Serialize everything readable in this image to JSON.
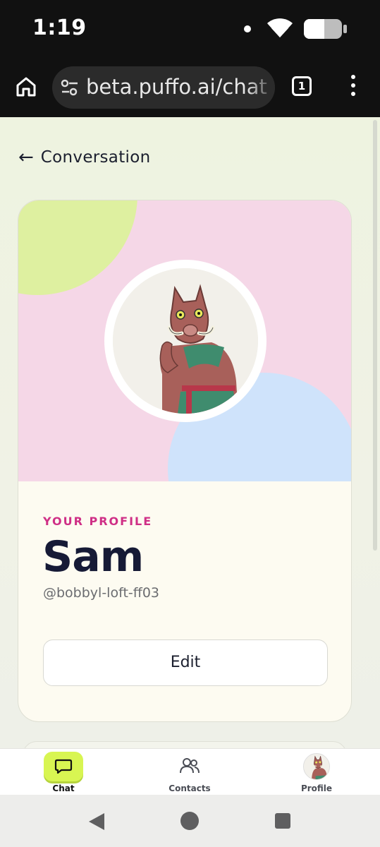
{
  "status_bar": {
    "time": "1:19"
  },
  "browser": {
    "url": "beta.puffo.ai/chat",
    "tab_count": "1"
  },
  "page": {
    "back_label": "Conversation",
    "profile": {
      "eyebrow": "YOUR PROFILE",
      "name": "Sam",
      "handle": "@bobbyl-loft-ff03",
      "edit_label": "Edit"
    }
  },
  "bottom_nav": {
    "items": [
      {
        "label": "Chat",
        "icon": "chat-bubble-icon",
        "active": true
      },
      {
        "label": "Contacts",
        "icon": "contacts-icon",
        "active": false
      },
      {
        "label": "Profile",
        "icon": "avatar",
        "active": false
      }
    ]
  },
  "colors": {
    "accent_pink": "#cf2f86",
    "accent_lime": "#d8f552",
    "banner_pink": "#f5d7e7",
    "blob_green": "#def0a0",
    "blob_blue": "#cfe3fb",
    "name_navy": "#161a36"
  }
}
